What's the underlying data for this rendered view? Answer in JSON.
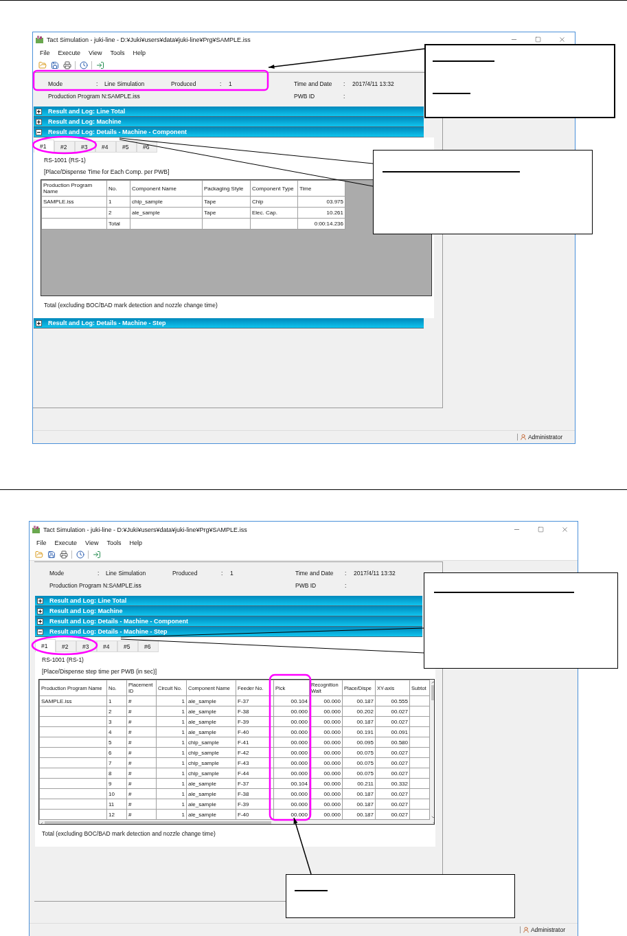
{
  "windows": [
    {
      "title": "Tact Simulation - juki-line - D:¥Juki¥users¥data¥juki-line¥Prg¥SAMPLE.iss",
      "menu": [
        "File",
        "Execute",
        "View",
        "Tools",
        "Help"
      ],
      "info": {
        "mode": {
          "label": "Mode",
          "separator": ":",
          "value": "Line Simulation"
        },
        "produced": {
          "label": "Produced",
          "separator": ":",
          "value": "1"
        },
        "time": {
          "label": "Time and Date",
          "separator": ":",
          "value": "2017/4/11 13:32"
        },
        "program": "Production Program N:SAMPLE.iss",
        "pwb": {
          "label": "PWB ID",
          "separator": ":"
        }
      },
      "sections": [
        {
          "label": "Result and Log: Line Total",
          "expanded": false
        },
        {
          "label": "Result and Log: Machine",
          "expanded": false
        },
        {
          "label": "Result and Log: Details - Machine - Component",
          "expanded": true,
          "content": {
            "tabs": [
              {
                "label": "#1",
                "selected": true
              },
              {
                "label": "#2",
                "selected": false
              },
              {
                "label": "#3",
                "selected": false
              },
              {
                "label": "#4",
                "selected": false
              },
              {
                "label": "#5",
                "selected": false
              },
              {
                "label": "#6",
                "selected": false
              }
            ],
            "machine": "RS-1001 (RS-1)",
            "caption": "[Place/Dispense Time for Each Comp. per PWB]",
            "table": {
              "scrollable": false,
              "columns": [
                "Production Program Name",
                "No.",
                "Component Name",
                "Packaging Style",
                "Component Type",
                "Time"
              ],
              "rows": [
                [
                  "SAMPLE.iss",
                  "1",
                  "chip_sample",
                  "Tape",
                  "Chip",
                  "03.975"
                ],
                [
                  null,
                  "2",
                  "ale_sample",
                  "Tape",
                  "Elec. Cap.",
                  "10.261"
                ],
                [
                  null,
                  "Total",
                  null,
                  null,
                  null,
                  "0:00:14.236"
                ]
              ]
            },
            "footer": "Total (excluding BOC/BAD mark detection and nozzle change time)"
          }
        },
        {
          "label": "Result and Log: Details - Machine - Step",
          "expanded": false
        }
      ],
      "status": "Administrator"
    },
    {
      "title": "Tact Simulation - juki-line - D:¥Juki¥users¥data¥juki-line¥Prg¥SAMPLE.iss",
      "menu": [
        "File",
        "Execute",
        "View",
        "Tools",
        "Help"
      ],
      "info": {
        "mode": {
          "label": "Mode",
          "separator": ":",
          "value": "Line Simulation"
        },
        "produced": {
          "label": "Produced",
          "separator": ":",
          "value": "1"
        },
        "time": {
          "label": "Time and Date",
          "separator": ":",
          "value": "2017/4/11 13:32"
        },
        "program": "Production Program N:SAMPLE.iss",
        "pwb": {
          "label": "PWB ID",
          "separator": ":"
        }
      },
      "sections": [
        {
          "label": "Result and Log: Line Total",
          "expanded": false
        },
        {
          "label": "Result and Log: Machine",
          "expanded": false
        },
        {
          "label": "Result and Log: Details - Machine - Component",
          "expanded": false
        },
        {
          "label": "Result and Log: Details - Machine - Step",
          "expanded": true,
          "content": {
            "tabs": [
              {
                "label": "#1",
                "selected": true
              },
              {
                "label": "#2",
                "selected": false
              },
              {
                "label": "#3",
                "selected": false
              },
              {
                "label": "#4",
                "selected": false
              },
              {
                "label": "#5",
                "selected": false
              },
              {
                "label": "#6",
                "selected": false
              }
            ],
            "machine": "RS-1001 (RS-1)",
            "caption": "[Place/Dispense step time per PWB (in sec)]",
            "table": {
              "scrollable": true,
              "columns": [
                "Production Program Name",
                "No.",
                "Placement ID",
                "Circuit No.",
                "Component Name",
                "Feeder No.",
                "Pick",
                "Recognition Wait",
                "Place/Dispe",
                "XY-axis",
                "Subtot"
              ],
              "rows": [
                [
                  "SAMPLE.iss",
                  "1",
                  "#",
                  "1",
                  "ale_sample",
                  "F-37",
                  "00.104",
                  "00.000",
                  "00.187",
                  "00.555",
                  null
                ],
                [
                  null,
                  "2",
                  "#",
                  "1",
                  "ale_sample",
                  "F-38",
                  "00.000",
                  "00.000",
                  "00.202",
                  "00.027",
                  null
                ],
                [
                  null,
                  "3",
                  "#",
                  "1",
                  "ale_sample",
                  "F-39",
                  "00.000",
                  "00.000",
                  "00.187",
                  "00.027",
                  null
                ],
                [
                  null,
                  "4",
                  "#",
                  "1",
                  "ale_sample",
                  "F-40",
                  "00.000",
                  "00.000",
                  "00.191",
                  "00.091",
                  null
                ],
                [
                  null,
                  "5",
                  "#",
                  "1",
                  "chip_sample",
                  "F-41",
                  "00.000",
                  "00.000",
                  "00.095",
                  "00.580",
                  null
                ],
                [
                  null,
                  "6",
                  "#",
                  "1",
                  "chip_sample",
                  "F-42",
                  "00.000",
                  "00.000",
                  "00.075",
                  "00.027",
                  null
                ],
                [
                  null,
                  "7",
                  "#",
                  "1",
                  "chip_sample",
                  "F-43",
                  "00.000",
                  "00.000",
                  "00.075",
                  "00.027",
                  null
                ],
                [
                  null,
                  "8",
                  "#",
                  "1",
                  "chip_sample",
                  "F-44",
                  "00.000",
                  "00.000",
                  "00.075",
                  "00.027",
                  null
                ],
                [
                  null,
                  "9",
                  "#",
                  "1",
                  "ale_sample",
                  "F-37",
                  "00.104",
                  "00.000",
                  "00.211",
                  "00.332",
                  null
                ],
                [
                  null,
                  "10",
                  "#",
                  "1",
                  "ale_sample",
                  "F-38",
                  "00.000",
                  "00.000",
                  "00.187",
                  "00.027",
                  null
                ],
                [
                  null,
                  "11",
                  "#",
                  "1",
                  "ale_sample",
                  "F-39",
                  "00.000",
                  "00.000",
                  "00.187",
                  "00.027",
                  null
                ],
                [
                  null,
                  "12",
                  "#",
                  "1",
                  "ale_sample",
                  "F-40",
                  "00.000",
                  "00.000",
                  "00.187",
                  "00.027",
                  null
                ]
              ]
            },
            "footer": "Total (excluding BOC/BAD mark detection and nozzle change time)"
          }
        }
      ],
      "status": "Administrator"
    }
  ]
}
